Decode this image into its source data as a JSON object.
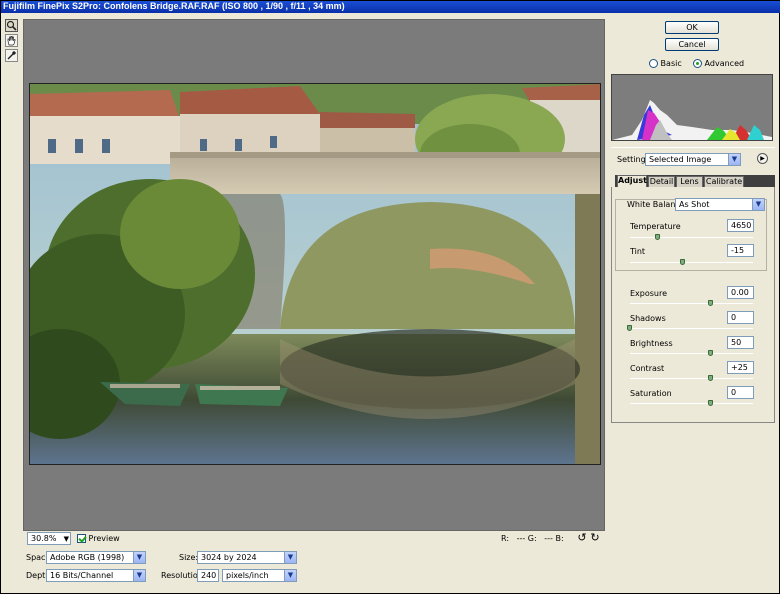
{
  "window": {
    "title": "Fujifilm FinePix S2Pro:  Confolens Bridge.RAF.RAF  (ISO 800 , 1/90 , f/11 , 34 mm)"
  },
  "tools": [
    {
      "name": "zoom-tool",
      "icon": "magnifier-icon",
      "glyph": "🔍"
    },
    {
      "name": "hand-tool",
      "icon": "hand-icon",
      "glyph": "✋"
    },
    {
      "name": "white-balance-tool",
      "icon": "eyedropper-icon",
      "glyph": "⟋"
    }
  ],
  "buttons": {
    "ok": "OK",
    "cancel": "Cancel"
  },
  "view_mode": {
    "basic": "Basic",
    "advanced": "Advanced",
    "selected": "Advanced"
  },
  "settings": {
    "label": "Settings:",
    "value": "Selected Image"
  },
  "tabs": [
    "Adjust",
    "Detail",
    "Lens",
    "Calibrate"
  ],
  "adjust": {
    "white_balance_label": "White Balance:",
    "white_balance_value": "As Shot",
    "temperature": {
      "label": "Temperature",
      "value": "4650",
      "level": 0.23
    },
    "tint": {
      "label": "Tint",
      "value": "-15",
      "level": 0.43
    },
    "exposure": {
      "label": "Exposure",
      "value": "0.00",
      "level": 0.66
    },
    "shadows": {
      "label": "Shadows",
      "value": "0",
      "level": 0.0
    },
    "brightness": {
      "label": "Brightness",
      "value": "50",
      "level": 0.66
    },
    "contrast": {
      "label": "Contrast",
      "value": "+25",
      "level": 0.66
    },
    "saturation": {
      "label": "Saturation",
      "value": "0",
      "level": 0.66
    }
  },
  "bottom": {
    "zoom": "30.8%",
    "preview_label": "Preview",
    "r_label": "R:",
    "r_value": "---",
    "g_label": "G:",
    "g_value": "---",
    "b_label": "B:",
    "b_value": "---"
  },
  "workflow": {
    "space_label": "Space:",
    "space_value": "Adobe RGB (1998)",
    "depth_label": "Depth:",
    "depth_value": "16 Bits/Channel",
    "size_label": "Size:",
    "size_value": "3024 by 2024",
    "resolution_label": "Resolution:",
    "resolution_value": "240",
    "resolution_unit": "pixels/inch"
  },
  "colors": {
    "titlebar": "#0a2fa8",
    "canvas_bg": "#7b7b7b",
    "histogram_bg": "#7d7d7d",
    "accent_green": "#21a121"
  }
}
